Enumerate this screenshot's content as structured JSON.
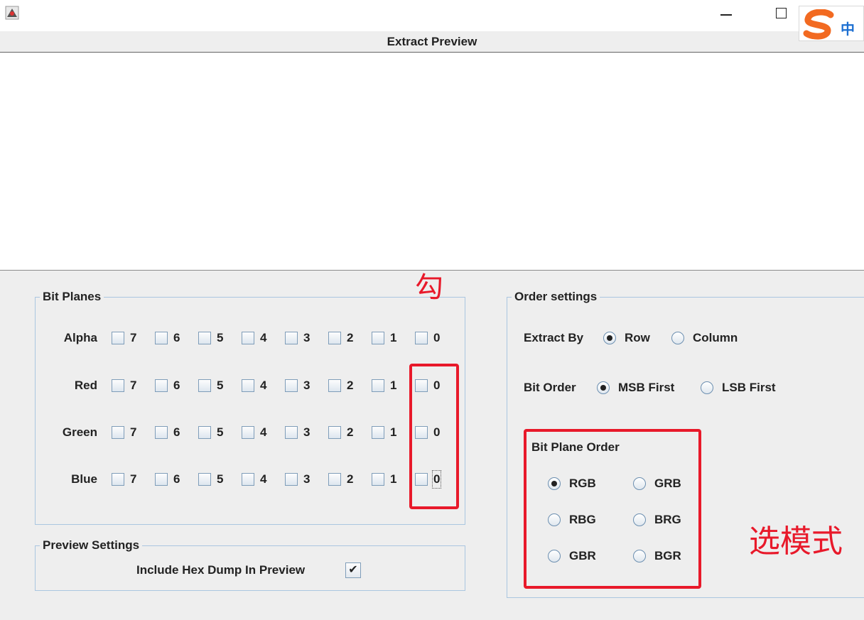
{
  "window": {
    "title": "Extract Preview",
    "close_glyph": "✕"
  },
  "ime": {
    "logo_letter": "S",
    "mode": "中"
  },
  "bit_planes": {
    "legend": "Bit Planes",
    "rows": [
      {
        "label": "Alpha",
        "bits": [
          "7",
          "6",
          "5",
          "4",
          "3",
          "2",
          "1",
          "0"
        ]
      },
      {
        "label": "Red",
        "bits": [
          "7",
          "6",
          "5",
          "4",
          "3",
          "2",
          "1",
          "0"
        ]
      },
      {
        "label": "Green",
        "bits": [
          "7",
          "6",
          "5",
          "4",
          "3",
          "2",
          "1",
          "0"
        ]
      },
      {
        "label": "Blue",
        "bits": [
          "7",
          "6",
          "5",
          "4",
          "3",
          "2",
          "1",
          "0"
        ]
      }
    ]
  },
  "preview_settings": {
    "legend": "Preview Settings",
    "hex_dump_label": "Include Hex Dump In Preview",
    "hex_dump_checked": true,
    "check_glyph": "✔"
  },
  "order_settings": {
    "legend": "Order settings",
    "extract_by": {
      "label": "Extract By",
      "options": [
        "Row",
        "Column"
      ],
      "selected": "Row"
    },
    "bit_order": {
      "label": "Bit Order",
      "options": [
        "MSB First",
        "LSB First"
      ],
      "selected": "MSB First"
    },
    "bit_plane_order": {
      "label": "Bit Plane Order",
      "options": [
        "RGB",
        "GRB",
        "RBG",
        "BRG",
        "GBR",
        "BGR"
      ],
      "selected": "RGB"
    }
  },
  "annotations": {
    "check_hint": "勾",
    "mode_hint": "选模式"
  },
  "colors": {
    "annotation_red": "#e8192a",
    "group_border": "#aac6e0",
    "background": "#eeeeee"
  }
}
